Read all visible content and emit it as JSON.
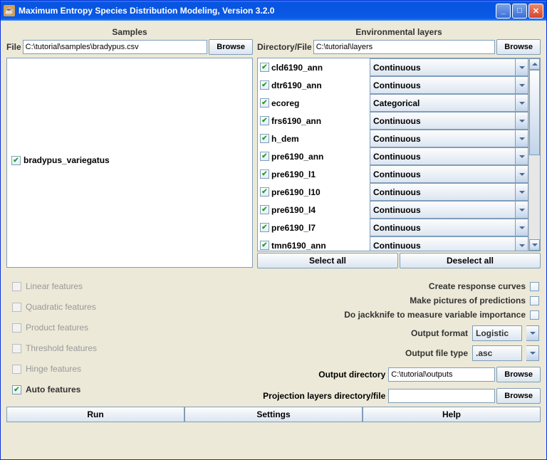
{
  "window": {
    "title": "Maximum Entropy Species Distribution Modeling, Version 3.2.0",
    "icon_char": "☕"
  },
  "samples": {
    "title": "Samples",
    "file_label": "File",
    "file_value": "C:\\tutorial\\samples\\bradypus.csv",
    "browse": "Browse",
    "species": [
      {
        "checked": true,
        "name": "bradypus_variegatus"
      }
    ]
  },
  "env": {
    "title": "Environmental layers",
    "dir_label": "Directory/File",
    "dir_value": "C:\\tutorial\\layers",
    "browse": "Browse",
    "layers": [
      {
        "checked": true,
        "name": "cld6190_ann",
        "type": "Continuous"
      },
      {
        "checked": true,
        "name": "dtr6190_ann",
        "type": "Continuous"
      },
      {
        "checked": true,
        "name": "ecoreg",
        "type": "Categorical"
      },
      {
        "checked": true,
        "name": "frs6190_ann",
        "type": "Continuous"
      },
      {
        "checked": true,
        "name": "h_dem",
        "type": "Continuous"
      },
      {
        "checked": true,
        "name": "pre6190_ann",
        "type": "Continuous"
      },
      {
        "checked": true,
        "name": "pre6190_l1",
        "type": "Continuous"
      },
      {
        "checked": true,
        "name": "pre6190_l10",
        "type": "Continuous"
      },
      {
        "checked": true,
        "name": "pre6190_l4",
        "type": "Continuous"
      },
      {
        "checked": true,
        "name": "pre6190_l7",
        "type": "Continuous"
      },
      {
        "checked": true,
        "name": "tmn6190_ann",
        "type": "Continuous"
      }
    ],
    "select_all": "Select all",
    "deselect_all": "Deselect all"
  },
  "features": {
    "linear": "Linear features",
    "quadratic": "Quadratic features",
    "product": "Product features",
    "threshold": "Threshold features",
    "hinge": "Hinge features",
    "auto": "Auto features"
  },
  "options": {
    "response_curves": "Create response curves",
    "pictures": "Make pictures of predictions",
    "jackknife": "Do jackknife to measure variable importance",
    "output_format_label": "Output format",
    "output_format_value": "Logistic",
    "output_file_type_label": "Output file type",
    "output_file_type_value": ".asc"
  },
  "outputs": {
    "output_dir_label": "Output directory",
    "output_dir_value": "C:\\tutorial\\outputs",
    "proj_label": "Projection layers directory/file",
    "proj_value": "",
    "browse": "Browse"
  },
  "actions": {
    "run": "Run",
    "settings": "Settings",
    "help": "Help"
  }
}
